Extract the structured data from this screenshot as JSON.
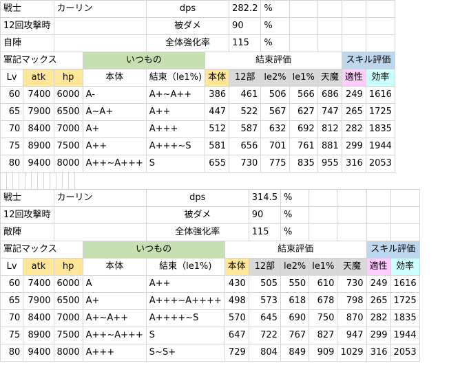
{
  "blocks": [
    {
      "info": [
        {
          "label": "戦士",
          "name": "カーリン",
          "key": "dps",
          "value": "282.2",
          "unit": "%"
        },
        {
          "label": "12回攻撃時",
          "name": "",
          "key": "被ダメ",
          "value": "90",
          "unit": "%"
        },
        {
          "label": "自陣",
          "name": "",
          "key": "全体強化率",
          "value": "115",
          "unit": "%"
        }
      ],
      "group_header": {
        "a": "軍記マックス",
        "b": "いつもの",
        "c": "結束評価",
        "d": "スキル評価"
      },
      "col_header": [
        "Lv",
        "atk",
        "hp",
        "本体",
        "結束（le1%)",
        "本体",
        "12部",
        "le2%",
        "le1%",
        "天魔",
        "適性",
        "効率"
      ],
      "rows": [
        [
          "60",
          "7400",
          "6000",
          "A-",
          "A+~A++",
          "386",
          "461",
          "506",
          "566",
          "686",
          "249",
          "1616"
        ],
        [
          "65",
          "7900",
          "6500",
          "A~A+",
          "A++",
          "447",
          "522",
          "567",
          "627",
          "747",
          "265",
          "1725"
        ],
        [
          "70",
          "8400",
          "7000",
          "A+",
          "A+++",
          "512",
          "587",
          "632",
          "692",
          "812",
          "282",
          "1835"
        ],
        [
          "75",
          "8900",
          "7500",
          "A++",
          "A+++~S",
          "581",
          "656",
          "701",
          "761",
          "881",
          "299",
          "1944"
        ],
        [
          "80",
          "9400",
          "8000",
          "A++~A+++",
          "S",
          "655",
          "730",
          "775",
          "835",
          "955",
          "316",
          "2053"
        ]
      ]
    },
    {
      "info": [
        {
          "label": "戦士",
          "name": "カーリン",
          "key": "dps",
          "value": "314.5",
          "unit": "%"
        },
        {
          "label": "12回攻撃時",
          "name": "",
          "key": "被ダメ",
          "value": "90",
          "unit": "%"
        },
        {
          "label": "敵陣",
          "name": "",
          "key": "全体強化率",
          "value": "115",
          "unit": "%"
        }
      ],
      "group_header": {
        "a": "軍記マックス",
        "b": "いつもの",
        "c": "結束評価",
        "d": "スキル評価"
      },
      "col_header": [
        "Lv",
        "atk",
        "hp",
        "本体",
        "結束（le1%)",
        "本体",
        "12部",
        "le2%",
        "le1%",
        "天魔",
        "適性",
        "効率"
      ],
      "rows": [
        [
          "60",
          "7400",
          "6000",
          "A",
          "A++",
          "430",
          "505",
          "550",
          "610",
          "730",
          "249",
          "1616"
        ],
        [
          "65",
          "7900",
          "6500",
          "A+",
          "A+++~A++++",
          "498",
          "573",
          "618",
          "678",
          "798",
          "265",
          "1725"
        ],
        [
          "70",
          "8400",
          "7000",
          "A+~A++",
          "A++++~S",
          "570",
          "645",
          "690",
          "750",
          "870",
          "282",
          "1835"
        ],
        [
          "75",
          "8900",
          "7500",
          "A++~A+++",
          "S",
          "647",
          "722",
          "767",
          "827",
          "947",
          "299",
          "1944"
        ],
        [
          "80",
          "9400",
          "8000",
          "A+++",
          "S~S+",
          "729",
          "804",
          "849",
          "909",
          "1029",
          "316",
          "2053"
        ]
      ]
    }
  ]
}
